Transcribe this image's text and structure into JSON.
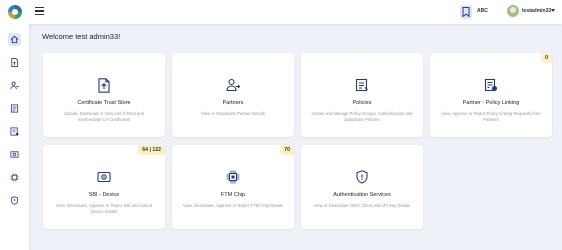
{
  "header": {
    "org_label": "ABC",
    "username": "testadmin33"
  },
  "sidebar": {
    "items": [
      {
        "icon": "home-icon"
      },
      {
        "icon": "certificate-icon"
      },
      {
        "icon": "partners-icon"
      },
      {
        "icon": "policies-icon"
      },
      {
        "icon": "policy-linking-icon"
      },
      {
        "icon": "sbi-device-icon"
      },
      {
        "icon": "ftm-chip-icon"
      },
      {
        "icon": "authentication-services-icon"
      }
    ]
  },
  "main": {
    "welcome": "Welcome test admin33!",
    "cards": [
      {
        "title": "Certificate Trust Store",
        "desc": "Upload, Download or View List of Root and Intermediate CA Certificates",
        "badge": null
      },
      {
        "title": "Partners",
        "desc": "View or Deactivate Partner Details",
        "badge": null
      },
      {
        "title": "Policies",
        "desc": "Create and Manage Policy Groups, Authentication and Datashare Policies",
        "badge": null
      },
      {
        "title": "Partner - Policy Linking",
        "desc": "View, Approve or Reject Policy Linking Requests from Partners",
        "badge": "0"
      },
      {
        "title": "SBI - Device",
        "desc": "View, Deactivate, Approve or Reject SBI and Linked Device Details",
        "badge": "64 | 122"
      },
      {
        "title": "FTM Chip",
        "desc": "View, Deactivate, Approve or Reject FTM Chip Details",
        "badge": "70"
      },
      {
        "title": "Authentication Services",
        "desc": "View or Deactivate OIDC Client and API Key Details",
        "badge": null
      }
    ]
  },
  "colors": {
    "accent": "#1e3a8a",
    "badge_bg": "#fdf0c2",
    "background": "#eef1f7"
  }
}
